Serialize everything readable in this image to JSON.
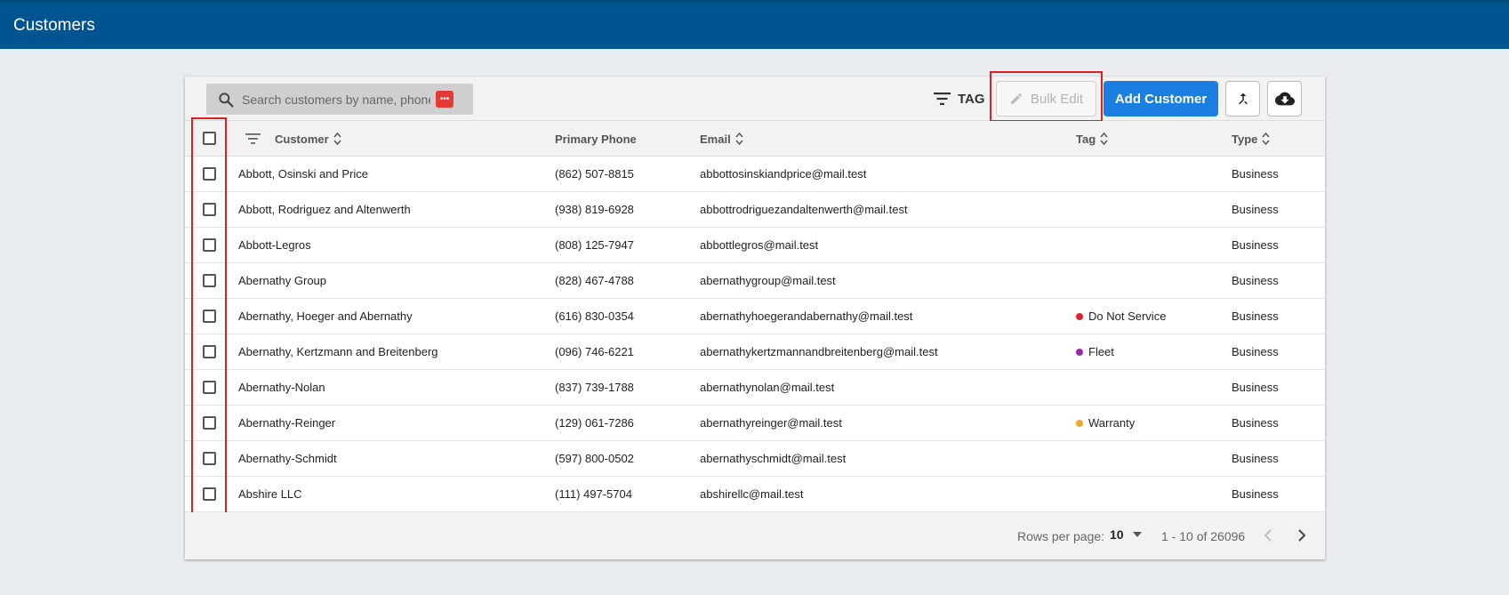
{
  "app": {
    "title": "Customers"
  },
  "toolbar": {
    "search_placeholder": "Search customers by name, phone or email",
    "password_badge": "•••",
    "tag_filter_label": "TAG",
    "bulk_edit_label": "Bulk Edit",
    "add_customer_label": "Add Customer"
  },
  "table": {
    "headers": {
      "customer": "Customer",
      "phone": "Primary Phone",
      "email": "Email",
      "tag": "Tag",
      "type": "Type"
    },
    "rows": [
      {
        "customer": "Abbott, Osinski and Price",
        "phone": "(862) 507-8815",
        "email": "abbottosinskiandprice@mail.test",
        "tag": "",
        "tag_color": "",
        "type": "Business"
      },
      {
        "customer": "Abbott, Rodriguez and Altenwerth",
        "phone": "(938) 819-6928",
        "email": "abbottrodriguezandaltenwerth@mail.test",
        "tag": "",
        "tag_color": "",
        "type": "Business"
      },
      {
        "customer": "Abbott-Legros",
        "phone": "(808) 125-7947",
        "email": "abbottlegros@mail.test",
        "tag": "",
        "tag_color": "",
        "type": "Business"
      },
      {
        "customer": "Abernathy Group",
        "phone": "(828) 467-4788",
        "email": "abernathygroup@mail.test",
        "tag": "",
        "tag_color": "",
        "type": "Business"
      },
      {
        "customer": "Abernathy, Hoeger and Abernathy",
        "phone": "(616) 830-0354",
        "email": "abernathyhoegerandabernathy@mail.test",
        "tag": "Do Not Service",
        "tag_color": "#e0202a",
        "type": "Business"
      },
      {
        "customer": "Abernathy, Kertzmann and Breitenberg",
        "phone": "(096) 746-6221",
        "email": "abernathykertzmannandbreitenberg@mail.test",
        "tag": "Fleet",
        "tag_color": "#9c27b0",
        "type": "Business"
      },
      {
        "customer": "Abernathy-Nolan",
        "phone": "(837) 739-1788",
        "email": "abernathynolan@mail.test",
        "tag": "",
        "tag_color": "",
        "type": "Business"
      },
      {
        "customer": "Abernathy-Reinger",
        "phone": "(129) 061-7286",
        "email": "abernathyreinger@mail.test",
        "tag": "Warranty",
        "tag_color": "#f5a623",
        "type": "Business"
      },
      {
        "customer": "Abernathy-Schmidt",
        "phone": "(597) 800-0502",
        "email": "abernathyschmidt@mail.test",
        "tag": "",
        "tag_color": "",
        "type": "Business"
      },
      {
        "customer": "Abshire LLC",
        "phone": "(111) 497-5704",
        "email": "abshirellc@mail.test",
        "tag": "",
        "tag_color": "",
        "type": "Business"
      }
    ]
  },
  "pagination": {
    "rows_per_page_label": "Rows per page:",
    "rows_per_page_value": "10",
    "range_text": "1 - 10 of 26096"
  },
  "colors": {
    "appbar": "#005590",
    "primary_button": "#1a7fe0",
    "highlight": "#e02020"
  }
}
